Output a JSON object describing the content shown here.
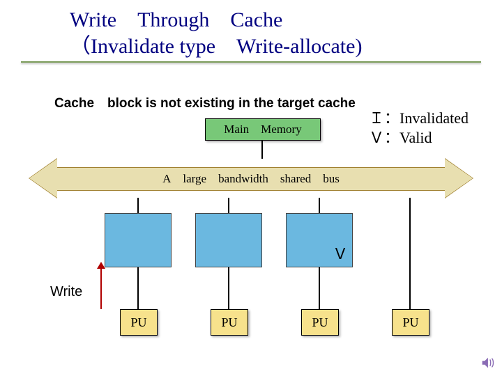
{
  "title_line1": "Write Through Cache",
  "title_line2": "（Invalidate type Write-allocate)",
  "subtitle": "Cache block is not existing in the target cache",
  "legend_line1": "Ｉ：Invalidated",
  "legend_line2": "Ｖ：Valid",
  "mainmem": "Main Memory",
  "bus_label": "A large bandwidth shared bus",
  "caches": {
    "c1_state": "",
    "c2_state": "",
    "c3_state": "Ｖ",
    "c4_state": ""
  },
  "pu_label": "PU",
  "write_label": "Write",
  "colors": {
    "title": "#000080",
    "bus_fill": "#e8dfb0",
    "cache_fill": "#6bb8e0",
    "pu_fill": "#f7e28c",
    "mainmem_fill": "#78c878",
    "write_arrow": "#b00000"
  }
}
